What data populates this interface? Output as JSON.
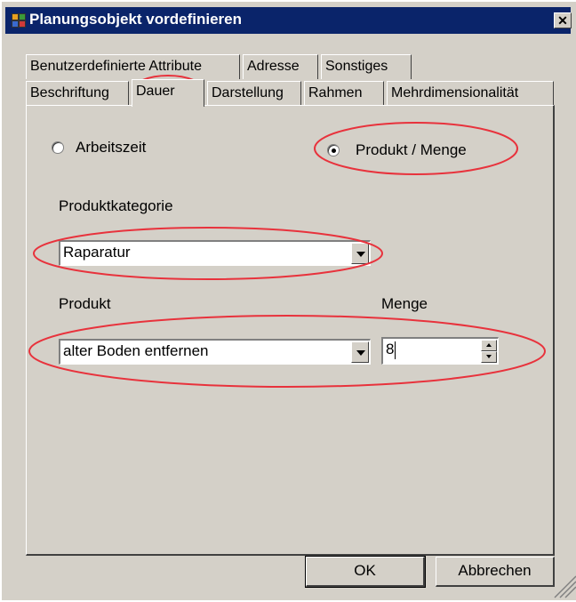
{
  "window": {
    "title": "Planungsobjekt vordefinieren",
    "close_glyph": "✕"
  },
  "tabs": {
    "row1": [
      "Benutzerdefinierte Attribute",
      "Adresse",
      "Sonstiges"
    ],
    "row2": [
      "Beschriftung",
      "Dauer",
      "Darstellung",
      "Rahmen",
      "Mehrdimensionalität"
    ],
    "active": "Dauer"
  },
  "dauer": {
    "radio_arbeitszeit": "Arbeitszeit",
    "radio_produkt_menge": "Produkt / Menge",
    "selected_radio": "Produkt / Menge",
    "produktkategorie_label": "Produktkategorie",
    "produktkategorie_value": "Raparatur",
    "produkt_label": "Produkt",
    "produkt_value": "alter Boden entfernen",
    "menge_label": "Menge",
    "menge_value": "8"
  },
  "buttons": {
    "ok": "OK",
    "cancel": "Abbrechen"
  },
  "annotation_color": "#e8323c"
}
